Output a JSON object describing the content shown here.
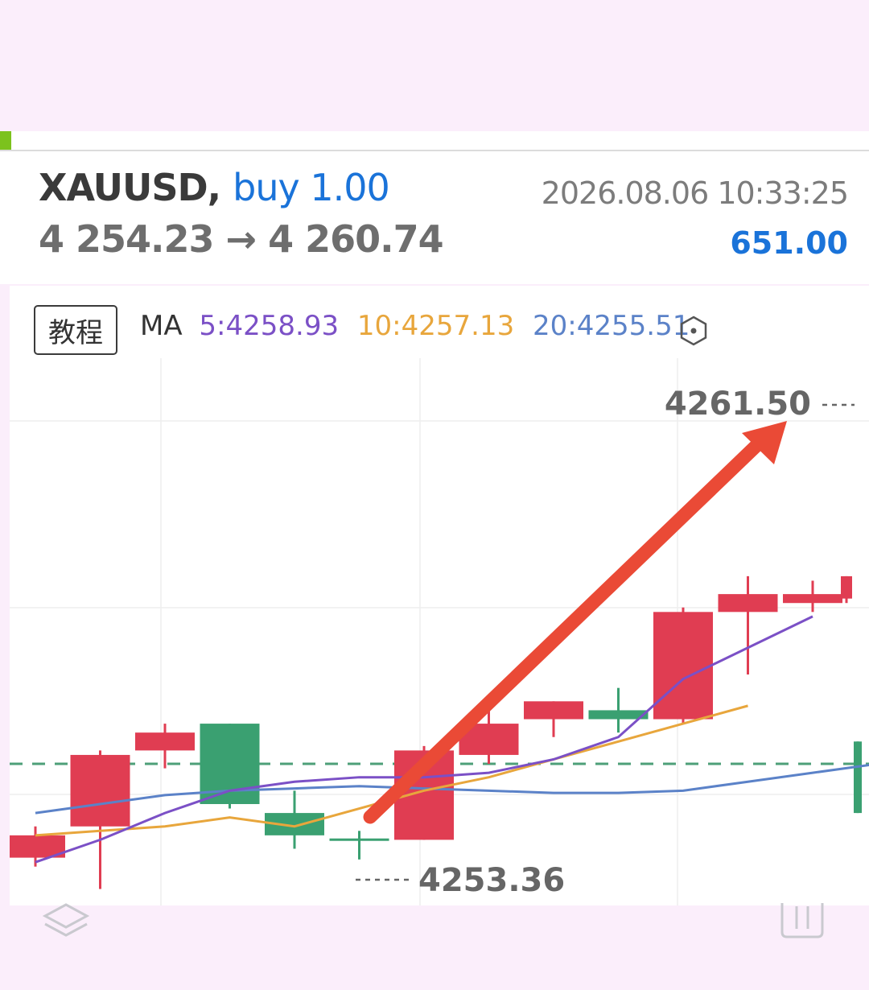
{
  "trade": {
    "symbol": "XAUUSD,",
    "side": "buy 1.00",
    "open_price": "4 254.23",
    "arrow": "→",
    "current_price": "4 260.74",
    "timestamp": "2026.08.06 10:33:25",
    "profit": "651.00"
  },
  "toolbar": {
    "tutorial_label": "教程",
    "ma_label": "MA",
    "ma5": "5:4258.93",
    "ma10": "10:4257.13",
    "ma20": "20:4255.51"
  },
  "icons": {
    "settings": "hexagon-settings-icon",
    "layers": "layers-icon",
    "trash": "trash-icon"
  },
  "colors": {
    "bull": "#e03d52",
    "bear": "#3aa071",
    "ma5": "#7b50c6",
    "ma10": "#e8a63c",
    "ma20": "#5b82c8",
    "annotation_arrow": "#ea4a36",
    "profit": "#1a73d9"
  },
  "chart_data": {
    "type": "candlestick",
    "high_label": "4261.50",
    "low_label": "4253.36",
    "price_range": [
      4252.6,
      4263.5
    ],
    "order_line": 4255.5,
    "candles": [
      {
        "o": 4253.9,
        "h": 4254.1,
        "l": 4253.2,
        "c": 4253.4,
        "color": "red"
      },
      {
        "o": 4254.1,
        "h": 4255.8,
        "l": 4252.7,
        "c": 4255.7,
        "color": "red"
      },
      {
        "o": 4255.8,
        "h": 4256.4,
        "l": 4255.4,
        "c": 4256.2,
        "color": "red"
      },
      {
        "o": 4256.4,
        "h": 4256.4,
        "l": 4254.5,
        "c": 4254.6,
        "color": "green"
      },
      {
        "o": 4254.4,
        "h": 4254.9,
        "l": 4253.6,
        "c": 4253.9,
        "color": "green"
      },
      {
        "o": 4253.83,
        "h": 4254.0,
        "l": 4253.36,
        "c": 4253.79,
        "color": "green"
      },
      {
        "o": 4253.8,
        "h": 4255.9,
        "l": 4253.8,
        "c": 4255.8,
        "color": "red"
      },
      {
        "o": 4255.7,
        "h": 4256.8,
        "l": 4255.5,
        "c": 4256.4,
        "color": "red"
      },
      {
        "o": 4256.5,
        "h": 4256.9,
        "l": 4256.1,
        "c": 4256.9,
        "color": "red"
      },
      {
        "o": 4256.7,
        "h": 4257.2,
        "l": 4256.2,
        "c": 4256.5,
        "color": "green"
      },
      {
        "o": 4256.5,
        "h": 4259.0,
        "l": 4256.4,
        "c": 4258.9,
        "color": "red"
      },
      {
        "o": 4258.9,
        "h": 4259.7,
        "l": 4257.5,
        "c": 4259.3,
        "color": "red"
      },
      {
        "o": 4259.1,
        "h": 4259.6,
        "l": 4258.9,
        "c": 4259.3,
        "color": "red"
      },
      {
        "o": 4259.2,
        "h": 4259.7,
        "l": 4259.1,
        "c": 4259.7,
        "color": "red"
      },
      {
        "o": 4256.0,
        "h": 4256.0,
        "l": 4254.4,
        "c": 4254.4,
        "color": "green"
      }
    ],
    "ma5_series": [
      4253.3,
      4253.8,
      4254.4,
      4254.9,
      4255.1,
      4255.2,
      4255.2,
      4255.3,
      4255.6,
      4256.1,
      4257.4,
      4258.1,
      4258.8
    ],
    "ma10_series": [
      4253.9,
      4254.0,
      4254.1,
      4254.3,
      4254.1,
      4254.5,
      4254.9,
      4255.2,
      4255.6,
      4256.0,
      4256.4,
      4256.8
    ],
    "ma20_series": [
      4254.4,
      4254.6,
      4254.8,
      4254.9,
      4254.95,
      4255.0,
      4254.95,
      4254.9,
      4254.85,
      4254.85,
      4254.9,
      4255.1,
      4255.3,
      4255.5
    ]
  }
}
